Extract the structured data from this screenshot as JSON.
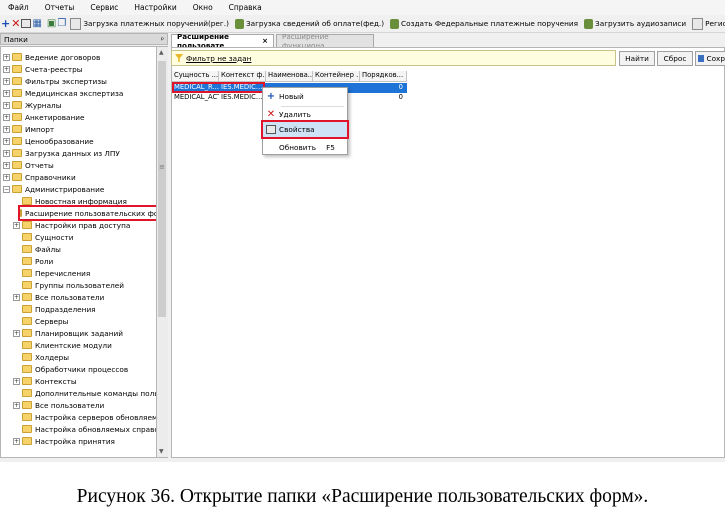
{
  "menubar": {
    "items": [
      "Файл",
      "Отчеты",
      "Сервис",
      "Настройки",
      "Окно",
      "Справка"
    ]
  },
  "toolbar": {
    "buttons": [
      "Загрузка платежных поручений(рег.)",
      "Загрузка сведений об оплате(фед.)",
      "Создать Федеральные платежные поручения",
      "Загрузить аудиозаписи",
      "Регистрация обращения"
    ]
  },
  "left_panel": {
    "title": "Папки",
    "pin": "ᵖ",
    "tree": [
      "Ведение договоров",
      "Счета-реестры",
      "Фильтры экспертизы",
      "Медицинская экспертиза",
      "Журналы",
      "Анкетирование",
      "Импорт",
      "Ценообразование",
      "Загрузка данных из ЛПУ",
      "Отчеты",
      "Справочники",
      "Администрирование",
      "Новостная информация",
      "Расширение пользовательских форм",
      "Настройки прав доступа",
      "Сущности",
      "Файлы",
      "Роли",
      "Перечисления",
      "Группы пользователей",
      "Все пользователи",
      "Подразделения",
      "Серверы",
      "Планировщик заданий",
      "Клиентские модули",
      "Холдеры",
      "Обработчики процессов",
      "Контексты",
      "Дополнительные команды пользователя",
      "Все пользователи",
      "Настройка серверов обновляемых справочников",
      "Настройка обновляемых справочников",
      "Настройка принятия"
    ]
  },
  "tabs": [
    {
      "label": "Расширение пользовате",
      "close": "×"
    },
    {
      "label": "Расширение функциона",
      "close": ""
    }
  ],
  "filter": {
    "label": "Фильтр не задан",
    "find": "Найти",
    "reset": "Сброс",
    "save": "Сохр"
  },
  "grid": {
    "headers": [
      "Сущность ...",
      "Контекст ф...",
      "Наименова...",
      "Контейнер ...",
      "Порядков..."
    ],
    "rows": [
      [
        "MEDICAL_R...",
        "IES.MEDIC...",
        "",
        "",
        "0"
      ],
      [
        "MEDICAL_ACT",
        "IES.MEDIC...",
        "",
        "",
        "0"
      ]
    ]
  },
  "context_menu": {
    "new": "Новый",
    "delete": "Удалить",
    "properties": "Свойства",
    "refresh": "Обновить",
    "refresh_shortcut": "F5"
  },
  "caption": "Рисунок 36. Открытие папки «Расширение пользовательских форм»."
}
